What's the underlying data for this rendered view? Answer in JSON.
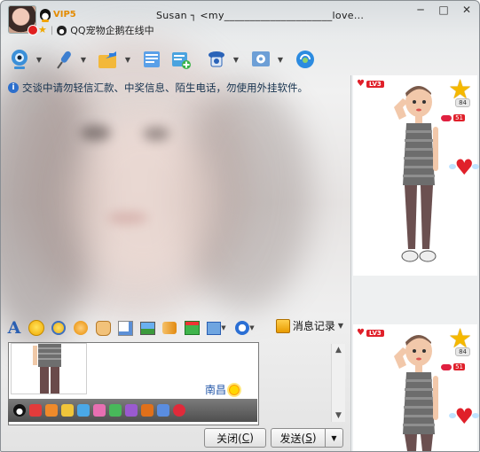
{
  "window": {
    "contact_title": "Susan ┐ <my_____________________love...",
    "vip_label": "VIP5",
    "pet_status": "QQ宠物企鹅在线中",
    "controls": [
      "─",
      "□",
      "✕"
    ]
  },
  "toolbar": {
    "items": [
      {
        "icon": "webcam-icon",
        "has_dropdown": true
      },
      {
        "icon": "microphone-icon",
        "has_dropdown": true
      },
      {
        "icon": "send-file-icon",
        "has_dropdown": true
      },
      {
        "icon": "mail-icon",
        "has_dropdown": false
      },
      {
        "icon": "add-app-icon",
        "has_dropdown": false
      },
      {
        "icon": "remote-assist-icon",
        "has_dropdown": true
      },
      {
        "icon": "settings-icon",
        "has_dropdown": true
      },
      {
        "icon": "music-icon",
        "has_dropdown": false
      }
    ]
  },
  "notice": "交谈中请勿轻信汇款、中奖信息、陌生电话，勿使用外挂软件。",
  "format_toolbar": {
    "font_button": "A",
    "history_label": "消息记录"
  },
  "input": {
    "location": "南昌"
  },
  "buttons": {
    "close_label": "关闭(",
    "close_key": "C",
    "close_suffix": ")",
    "send_label": "发送(",
    "send_key": "S",
    "send_suffix": ")",
    "send_dropdown": "▼"
  },
  "show_panels": [
    {
      "level": "LV3",
      "stars": "84",
      "lips": "51"
    },
    {
      "level": "LV3",
      "stars": "84",
      "lips": "51"
    }
  ],
  "colors": {
    "accent": "#2a5fb2",
    "vip": "#e38b00",
    "level_red": "#e0202a",
    "star": "#f5b800"
  }
}
